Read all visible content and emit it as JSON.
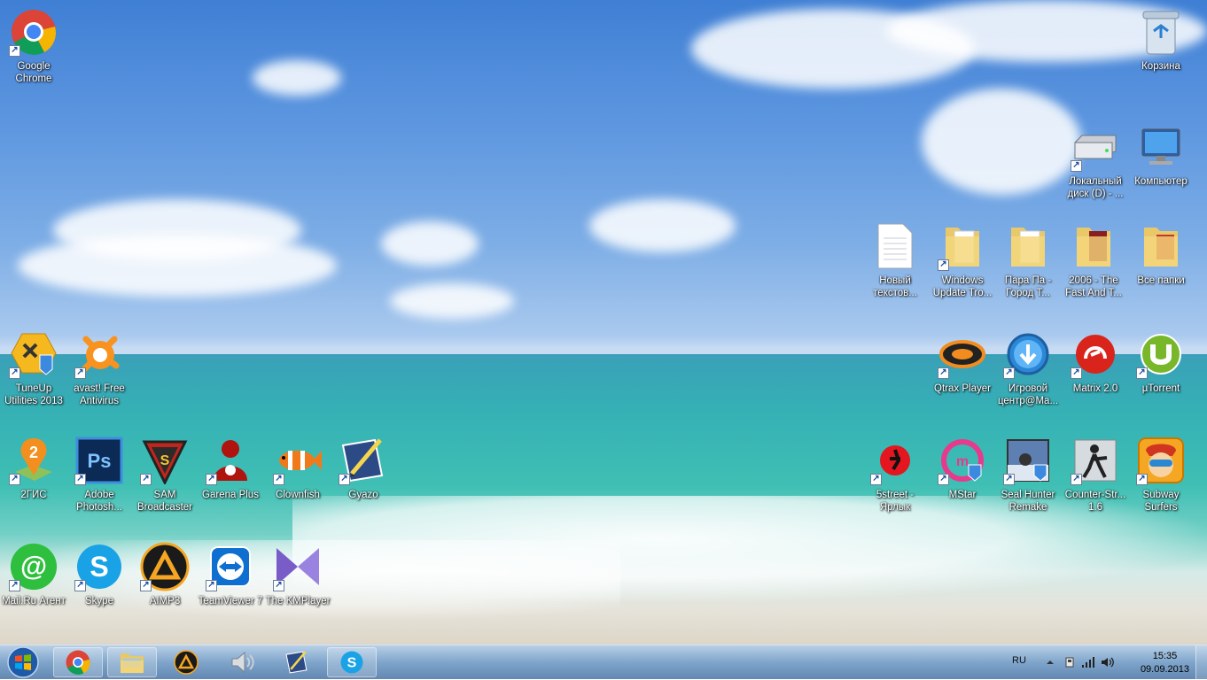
{
  "desktop_icons": [
    {
      "id": "chrome",
      "label": "Google Chrome",
      "icon": "chrome-icon",
      "shortcut": true
    },
    {
      "id": "recycle",
      "label": "Корзина",
      "icon": "recycle-bin-icon",
      "shortcut": false
    },
    {
      "id": "disk-d",
      "label": "Локальный диск (D) - ...",
      "icon": "hard-drive-icon",
      "shortcut": true
    },
    {
      "id": "computer",
      "label": "Компьютер",
      "icon": "computer-icon",
      "shortcut": false
    },
    {
      "id": "newtxt",
      "label": "Новый текстов...",
      "icon": "text-document-icon",
      "shortcut": false
    },
    {
      "id": "winupdate",
      "label": "Windows Update Tro...",
      "icon": "folder-icon",
      "shortcut": true
    },
    {
      "id": "parapa",
      "label": "Пара Па - Город Т...",
      "icon": "folder-icon",
      "shortcut": false
    },
    {
      "id": "f2006",
      "label": "2006 - The Fast And T...",
      "icon": "folder-icon",
      "shortcut": false
    },
    {
      "id": "allfolders",
      "label": "Все папки",
      "icon": "folder-icon",
      "shortcut": false
    },
    {
      "id": "tuneup",
      "label": "TuneUp Utilities 2013",
      "icon": "tuneup-icon",
      "shortcut": true
    },
    {
      "id": "avast",
      "label": "avast! Free Antivirus",
      "icon": "avast-icon",
      "shortcut": true
    },
    {
      "id": "qtrax",
      "label": "Qtrax Player",
      "icon": "qtrax-icon",
      "shortcut": true
    },
    {
      "id": "gamecenter",
      "label": "Игровой центр@Ma...",
      "icon": "game-center-icon",
      "shortcut": true
    },
    {
      "id": "matrix",
      "label": "Matrix 2.0",
      "icon": "matrix-icon",
      "shortcut": true
    },
    {
      "id": "utorrent",
      "label": "µTorrent",
      "icon": "utorrent-icon",
      "shortcut": true
    },
    {
      "id": "2gis",
      "label": "2ГИС",
      "icon": "2gis-icon",
      "shortcut": true
    },
    {
      "id": "photoshop",
      "label": "Adobe Photosh...",
      "icon": "photoshop-icon",
      "shortcut": true
    },
    {
      "id": "sam",
      "label": "SAM Broadcaster",
      "icon": "sam-icon",
      "shortcut": true
    },
    {
      "id": "garena",
      "label": "Garena Plus",
      "icon": "garena-icon",
      "shortcut": true
    },
    {
      "id": "clownfish",
      "label": "Clownfish",
      "icon": "clownfish-icon",
      "shortcut": true
    },
    {
      "id": "gyazo",
      "label": "Gyazo",
      "icon": "gyazo-icon",
      "shortcut": true
    },
    {
      "id": "5street",
      "label": "5street - Ярлык",
      "icon": "5street-icon",
      "shortcut": true
    },
    {
      "id": "mstar",
      "label": "MStar",
      "icon": "mstar-icon",
      "shortcut": true
    },
    {
      "id": "sealhunter",
      "label": "Seal Hunter Remake",
      "icon": "seal-hunter-icon",
      "shortcut": true
    },
    {
      "id": "cs16",
      "label": "Counter-Str... 1.6",
      "icon": "counter-strike-icon",
      "shortcut": true
    },
    {
      "id": "subway",
      "label": "Subway Surfers",
      "icon": "subway-surfers-icon",
      "shortcut": true
    },
    {
      "id": "mailru",
      "label": "Mail.Ru Агент",
      "icon": "mailru-agent-icon",
      "shortcut": true
    },
    {
      "id": "skype",
      "label": "Skype",
      "icon": "skype-icon",
      "shortcut": true
    },
    {
      "id": "aimp",
      "label": "AIMP3",
      "icon": "aimp-icon",
      "shortcut": true
    },
    {
      "id": "teamviewer",
      "label": "TeamViewer 7",
      "icon": "teamviewer-icon",
      "shortcut": true
    },
    {
      "id": "kmplayer",
      "label": "The KMPlayer",
      "icon": "kmplayer-icon",
      "shortcut": true
    }
  ],
  "taskbar": {
    "start_icon": "windows-start-icon",
    "pinned": [
      {
        "id": "chrome",
        "icon": "chrome-icon",
        "open": true
      },
      {
        "id": "explorer",
        "icon": "explorer-icon",
        "open": true
      },
      {
        "id": "aimp",
        "icon": "aimp-icon",
        "open": false
      },
      {
        "id": "sound",
        "icon": "speaker-icon",
        "open": false
      },
      {
        "id": "gyazo",
        "icon": "gyazo-icon",
        "open": false
      },
      {
        "id": "skype",
        "icon": "skype-icon",
        "open": true
      }
    ],
    "tray": {
      "language": "RU",
      "time": "15:35",
      "date": "09.09.2013"
    }
  }
}
